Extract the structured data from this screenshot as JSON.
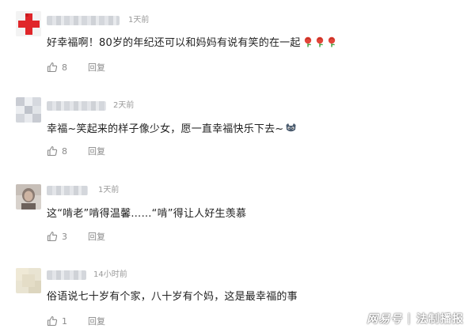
{
  "comments": [
    {
      "time": "1天前",
      "text": "好幸福啊！80岁的年纪还可以和妈妈有说有笑的在一起",
      "emoji": [
        "rose-emoji",
        "rose-emoji",
        "rose-emoji"
      ],
      "likes": "8",
      "reply": "回复",
      "avatar": "red-cross-avatar"
    },
    {
      "time": "2天前",
      "text": "幸福~笑起来的样子像少女，愿一直幸福快乐下去~",
      "emoji": [
        "cat-face-emoji"
      ],
      "likes": "8",
      "reply": "回复",
      "avatar": "blurred-avatar"
    },
    {
      "time": "1天前",
      "text": "这“啃老”啃得温馨……“啃”得让人好生羡慕",
      "emoji": [],
      "likes": "3",
      "reply": "回复",
      "avatar": "portrait-avatar"
    },
    {
      "time": "14小时前",
      "text": "俗语说七十岁有个家，八十岁有个妈，这是最幸福的事",
      "emoji": [],
      "likes": "1",
      "reply": "回复",
      "avatar": "beige-avatar"
    }
  ],
  "watermark": {
    "brand": "网易号",
    "separator": "|",
    "source": "法制播报"
  },
  "colors": {
    "text": "#222222",
    "meta": "#999999",
    "avatar_red": "#e0262a",
    "rose": "#e2463a"
  }
}
